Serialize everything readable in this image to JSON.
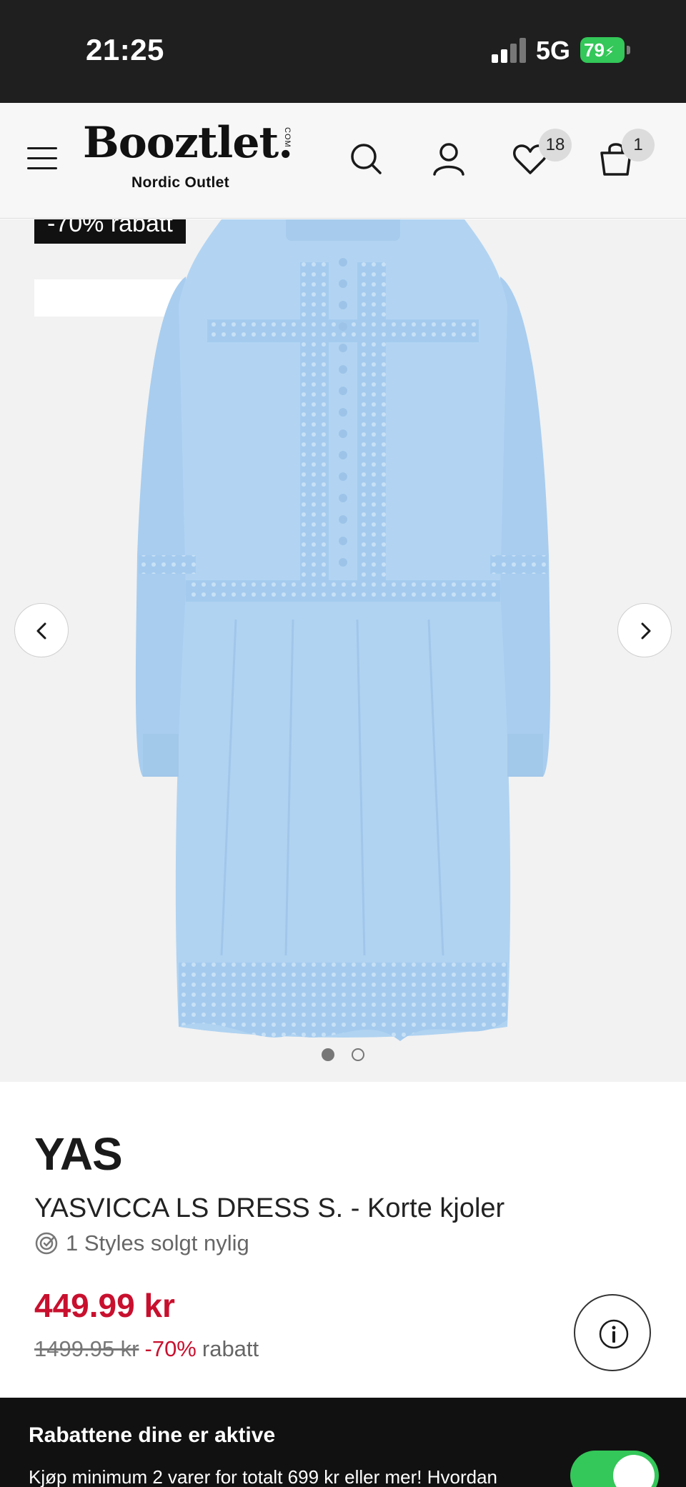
{
  "status_bar": {
    "time": "21:25",
    "network": "5G",
    "battery": "79"
  },
  "header": {
    "logo_text": "Booztlet.",
    "logo_com": "COM",
    "logo_subtitle": "Nordic Outlet",
    "wishlist_count": "18",
    "cart_count": "1",
    "icons": [
      "menu-icon",
      "search-icon",
      "user-icon",
      "heart-icon",
      "bag-icon"
    ]
  },
  "gallery": {
    "discount_tag": "-70% rabatt",
    "image_alt": "Light blue long sleeve dress with lace trim",
    "image_count": 2,
    "active_image": 1
  },
  "product": {
    "brand": "YAS",
    "name": "YASVICCA LS DRESS S. - Korte kjoler",
    "sold_text": "1 Styles solgt nylig",
    "price": "449.99 kr",
    "old_price": "1499.95 kr",
    "discount_pct": "-70%",
    "discount_word": "rabatt"
  },
  "promo": {
    "title": "Rabattene dine er aktive",
    "text": "Kjøp minimum 2 varer for totalt 699 kr eller mer! Hvordan",
    "toggle_on": true
  },
  "colors": {
    "accent_red": "#c8102e",
    "toggle_green": "#34c759",
    "dress_blue": "#aed2f1"
  }
}
